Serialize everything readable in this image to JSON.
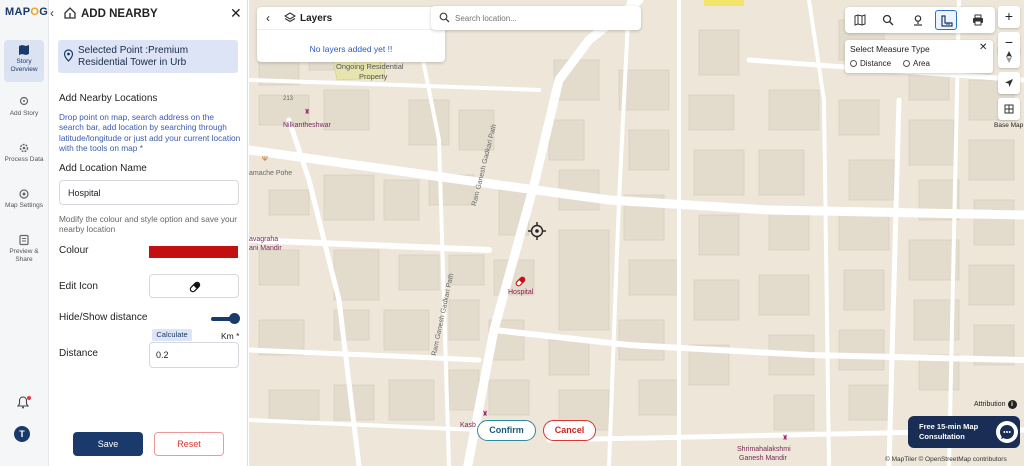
{
  "app": {
    "logo_prefix": "MAP",
    "logo_suffix": "O",
    "logo_tail": "G"
  },
  "rail": {
    "items": [
      {
        "label": "Story Overview",
        "icon": "map-book-icon"
      },
      {
        "label": "Add Story",
        "icon": "location-icon"
      },
      {
        "label": "Process Data",
        "icon": "gear-icon"
      },
      {
        "label": "Map Settings",
        "icon": "settings-icon"
      },
      {
        "label": "Preview & Share",
        "icon": "preview-icon"
      }
    ],
    "avatar": "T"
  },
  "panel": {
    "title": "ADD NEARBY",
    "selected_point": "Selected Point :Premium Residential Tower in Urb",
    "section_title": "Add Nearby Locations",
    "help_text": "Drop point on map, search address on the search bar, add location by searching through latitude/longitude or just add your current location with the tools on map *",
    "location_name_label": "Add Location Name",
    "location_name_value": "Hospital",
    "modify_text": "Modify the colour and style option and save your nearby location",
    "colour_label": "Colour",
    "colour_value": "#c30f0f",
    "edit_icon_label": "Edit Icon",
    "hide_show_label": "Hide/Show distance",
    "toggle_on": true,
    "calculate_label": "Calculate",
    "unit_label": "Km *",
    "distance_label": "Distance",
    "distance_value": "0.2",
    "save_label": "Save",
    "reset_label": "Reset"
  },
  "map": {
    "layers_title": "Layers",
    "layers_empty": "No layers added yet !!",
    "search_placeholder": "Search location...",
    "measure_title": "Select Measure Type",
    "measure_options": [
      "Distance",
      "Area"
    ],
    "basemap_label": "Base Map",
    "marker_label": "Hospital",
    "confirm_label": "Confirm",
    "cancel_label": "Cancel",
    "attribution_label": "Attribution",
    "consult_text": "Free 15-min Map Consultation",
    "copyright": "© MapTiler © OpenStreetMap contributors",
    "labels": {
      "ongoing_1": "Ongoing Residential",
      "ongoing_2": "Property",
      "nilkantheshwar": "Nilkantheshwar",
      "num_213": "213",
      "amache_pohe": "amache Pohe",
      "vagraha_1": "avagraha",
      "vagraha_2": "ani Mandir",
      "road_1": "Ram Ganesh Gadkari Path",
      "road_2": "Ram Ganesh Gadkari Path",
      "kasb": "Kasb",
      "shrimahalakshmi_1": "Shrimahalakshmi",
      "shrimahalakshmi_2": "Ganesh Mandir"
    }
  }
}
